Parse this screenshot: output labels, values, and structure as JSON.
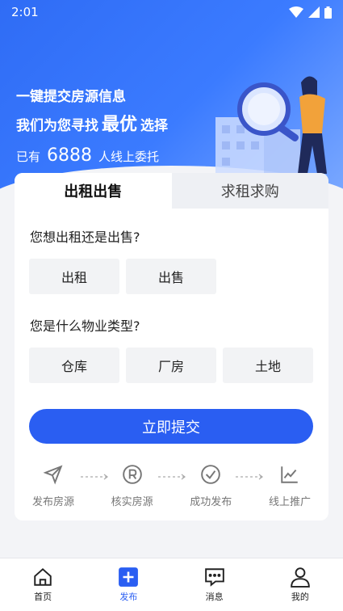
{
  "status": {
    "time": "2:01"
  },
  "hero": {
    "line1": "一键提交房源信息",
    "line2_prefix": "我们为您寻找",
    "line2_big": "最优",
    "line2_suffix": "选择",
    "line3_prefix": "已有",
    "line3_count": "6888",
    "line3_suffix": "人线上委托"
  },
  "tabs": [
    {
      "label": "出租出售",
      "active": true
    },
    {
      "label": "求租求购",
      "active": false
    }
  ],
  "q1": {
    "question": "您想出租还是出售?",
    "options": [
      "出租",
      "出售"
    ]
  },
  "q2": {
    "question": "您是什么物业类型?",
    "options": [
      "仓库",
      "厂房",
      "土地"
    ]
  },
  "submit_label": "立即提交",
  "steps": [
    {
      "label": "发布房源",
      "icon": "send-icon"
    },
    {
      "label": "核实房源",
      "icon": "registered-icon"
    },
    {
      "label": "成功发布",
      "icon": "check-circle-icon"
    },
    {
      "label": "线上推广",
      "icon": "chart-icon"
    }
  ],
  "nav": [
    {
      "label": "首页",
      "icon": "home-icon",
      "active": false
    },
    {
      "label": "发布",
      "icon": "plus-icon",
      "active": true
    },
    {
      "label": "消息",
      "icon": "message-icon",
      "active": false
    },
    {
      "label": "我的",
      "icon": "user-icon",
      "active": false
    }
  ],
  "colors": {
    "primary": "#2a5ef2",
    "hero_start": "#2f6cf5",
    "hero_end": "#7aa8ff"
  }
}
